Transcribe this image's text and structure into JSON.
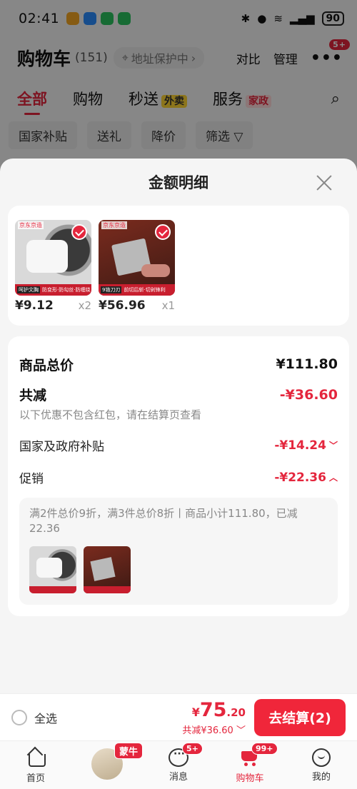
{
  "status_bar": {
    "time": "02:41",
    "battery": "90"
  },
  "header": {
    "title": "购物车",
    "count": "(151)",
    "address_chip": "地址保护中",
    "compare": "对比",
    "manage": "管理",
    "more_badge": "5+"
  },
  "tabs": [
    {
      "label": "全部"
    },
    {
      "label": "购物"
    },
    {
      "label": "秒送",
      "tag": "外卖"
    },
    {
      "label": "服务",
      "tag": "家政"
    }
  ],
  "filters": [
    "国家补贴",
    "送礼",
    "降价",
    "筛选"
  ],
  "sheet": {
    "title": "金额明细",
    "products": [
      {
        "price": "¥9.12",
        "qty": "x2",
        "strip_a": "呵护文胸",
        "strip_b": "防变形·防勾丝·防缠绕"
      },
      {
        "price": "¥56.96",
        "qty": "x1",
        "strip_a": "9铬刀刃",
        "strip_b": "前切后斩·切剁锋利"
      }
    ],
    "total_label": "商品总价",
    "total_value": "¥111.80",
    "discount_label": "共减",
    "discount_value": "-¥36.60",
    "discount_note": "以下优惠不包含红包，请在结算页查看",
    "subsidy_label": "国家及政府补贴",
    "subsidy_value": "-¥14.24",
    "promo_label": "促销",
    "promo_value": "-¥22.36",
    "promo_detail": "满2件总价9折，满3件总价8折丨商品小计111.80，已减22.36"
  },
  "checkout": {
    "select_all": "全选",
    "price_symbol": "¥",
    "price_int": "75",
    "price_dec": ".20",
    "saved": "共减¥36.60",
    "button": "去结算(2)"
  },
  "bottom_nav": {
    "home": "首页",
    "product_badge": "蒙牛",
    "messages": "消息",
    "messages_badge": "5+",
    "cart": "购物车",
    "cart_badge": "99+",
    "me": "我的"
  }
}
